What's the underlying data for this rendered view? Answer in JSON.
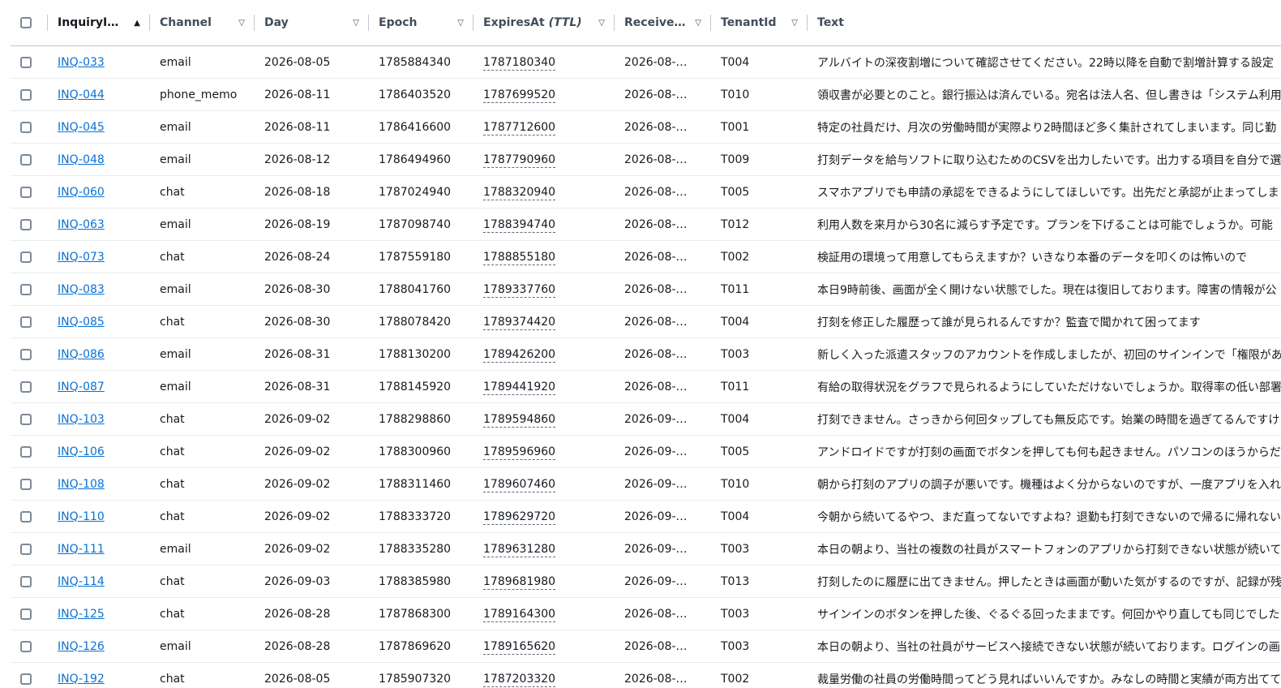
{
  "columns": [
    {
      "key": "inquiry_id",
      "label": "InquiryI…",
      "sort": "asc"
    },
    {
      "key": "channel",
      "label": "Channel",
      "sort": "none"
    },
    {
      "key": "day",
      "label": "Day",
      "sort": "none"
    },
    {
      "key": "epoch",
      "label": "Epoch",
      "sort": "none"
    },
    {
      "key": "expires",
      "label": "ExpiresAt",
      "label_suffix": "(TTL)",
      "sort": "none"
    },
    {
      "key": "received",
      "label": "Receive…",
      "sort": "none"
    },
    {
      "key": "tenant",
      "label": "TenantId",
      "sort": "none"
    },
    {
      "key": "text",
      "label": "Text",
      "sort": "none"
    }
  ],
  "rows": [
    {
      "id": "INQ-033",
      "channel": "email",
      "day": "2026-08-05",
      "epoch": "1785884340",
      "expires": "1787180340",
      "received": "2026-08-…",
      "tenant": "T004",
      "text": "アルバイトの深夜割増について確認させてください。22時以降を自動で割増計算する設定"
    },
    {
      "id": "INQ-044",
      "channel": "phone_memo",
      "day": "2026-08-11",
      "epoch": "1786403520",
      "expires": "1787699520",
      "received": "2026-08-…",
      "tenant": "T010",
      "text": "領収書が必要とのこと。銀行振込は済んでいる。宛名は法人名、但し書きは「システム利用"
    },
    {
      "id": "INQ-045",
      "channel": "email",
      "day": "2026-08-11",
      "epoch": "1786416600",
      "expires": "1787712600",
      "received": "2026-08-…",
      "tenant": "T001",
      "text": "特定の社員だけ、月次の労働時間が実際より2時間ほど多く集計されてしまいます。同じ勤"
    },
    {
      "id": "INQ-048",
      "channel": "email",
      "day": "2026-08-12",
      "epoch": "1786494960",
      "expires": "1787790960",
      "received": "2026-08-…",
      "tenant": "T009",
      "text": "打刻データを給与ソフトに取り込むためのCSVを出力したいです。出力する項目を自分で選"
    },
    {
      "id": "INQ-060",
      "channel": "chat",
      "day": "2026-08-18",
      "epoch": "1787024940",
      "expires": "1788320940",
      "received": "2026-08-…",
      "tenant": "T005",
      "text": "スマホアプリでも申請の承認をできるようにしてほしいです。出先だと承認が止まってしま"
    },
    {
      "id": "INQ-063",
      "channel": "email",
      "day": "2026-08-19",
      "epoch": "1787098740",
      "expires": "1788394740",
      "received": "2026-08-…",
      "tenant": "T012",
      "text": "利用人数を来月から30名に減らす予定です。プランを下げることは可能でしょうか。可能"
    },
    {
      "id": "INQ-073",
      "channel": "chat",
      "day": "2026-08-24",
      "epoch": "1787559180",
      "expires": "1788855180",
      "received": "2026-08-…",
      "tenant": "T002",
      "text": "検証用の環境って用意してもらえますか？いきなり本番のデータを叩くのは怖いので"
    },
    {
      "id": "INQ-083",
      "channel": "email",
      "day": "2026-08-30",
      "epoch": "1788041760",
      "expires": "1789337760",
      "received": "2026-08-…",
      "tenant": "T011",
      "text": "本日9時前後、画面が全く開けない状態でした。現在は復旧しております。障害の情報が公"
    },
    {
      "id": "INQ-085",
      "channel": "chat",
      "day": "2026-08-30",
      "epoch": "1788078420",
      "expires": "1789374420",
      "received": "2026-08-…",
      "tenant": "T004",
      "text": "打刻を修正した履歴って誰が見られるんですか？監査で聞かれて困ってます"
    },
    {
      "id": "INQ-086",
      "channel": "email",
      "day": "2026-08-31",
      "epoch": "1788130200",
      "expires": "1789426200",
      "received": "2026-08-…",
      "tenant": "T003",
      "text": "新しく入った派遣スタッフのアカウントを作成しましたが、初回のサインインで「権限があ"
    },
    {
      "id": "INQ-087",
      "channel": "email",
      "day": "2026-08-31",
      "epoch": "1788145920",
      "expires": "1789441920",
      "received": "2026-08-…",
      "tenant": "T011",
      "text": "有給の取得状況をグラフで見られるようにしていただけないでしょうか。取得率の低い部署"
    },
    {
      "id": "INQ-103",
      "channel": "chat",
      "day": "2026-09-02",
      "epoch": "1788298860",
      "expires": "1789594860",
      "received": "2026-09-…",
      "tenant": "T004",
      "text": "打刻できません。さっきから何回タップしても無反応です。始業の時間を過ぎてるんですけ"
    },
    {
      "id": "INQ-106",
      "channel": "chat",
      "day": "2026-09-02",
      "epoch": "1788300960",
      "expires": "1789596960",
      "received": "2026-09-…",
      "tenant": "T005",
      "text": "アンドロイドですが打刻の画面でボタンを押しても何も起きません。パソコンのほうからだ"
    },
    {
      "id": "INQ-108",
      "channel": "chat",
      "day": "2026-09-02",
      "epoch": "1788311460",
      "expires": "1789607460",
      "received": "2026-09-…",
      "tenant": "T010",
      "text": "朝から打刻のアプリの調子が悪いです。機種はよく分からないのですが、一度アプリを入れ"
    },
    {
      "id": "INQ-110",
      "channel": "chat",
      "day": "2026-09-02",
      "epoch": "1788333720",
      "expires": "1789629720",
      "received": "2026-09-…",
      "tenant": "T004",
      "text": "今朝から続いてるやつ、まだ直ってないですよね？退勤も打刻できないので帰るに帰れない"
    },
    {
      "id": "INQ-111",
      "channel": "email",
      "day": "2026-09-02",
      "epoch": "1788335280",
      "expires": "1789631280",
      "received": "2026-09-…",
      "tenant": "T003",
      "text": "本日の朝より、当社の複数の社員がスマートフォンのアプリから打刻できない状態が続いて"
    },
    {
      "id": "INQ-114",
      "channel": "chat",
      "day": "2026-09-03",
      "epoch": "1788385980",
      "expires": "1789681980",
      "received": "2026-09-…",
      "tenant": "T013",
      "text": "打刻したのに履歴に出てきません。押したときは画面が動いた気がするのですが、記録が残"
    },
    {
      "id": "INQ-125",
      "channel": "chat",
      "day": "2026-08-28",
      "epoch": "1787868300",
      "expires": "1789164300",
      "received": "2026-08-…",
      "tenant": "T003",
      "text": "サインインのボタンを押した後、ぐるぐる回ったままです。何回かやり直しても同じでした"
    },
    {
      "id": "INQ-126",
      "channel": "email",
      "day": "2026-08-28",
      "epoch": "1787869620",
      "expires": "1789165620",
      "received": "2026-08-…",
      "tenant": "T003",
      "text": "本日の朝より、当社の社員がサービスへ接続できない状態が続いております。ログインの画"
    },
    {
      "id": "INQ-192",
      "channel": "chat",
      "day": "2026-08-05",
      "epoch": "1785907320",
      "expires": "1787203320",
      "received": "2026-08-…",
      "tenant": "T002",
      "text": "裁量労働の社員の労働時間ってどう見ればいいんですか。みなしの時間と実績が両方出てて"
    }
  ]
}
